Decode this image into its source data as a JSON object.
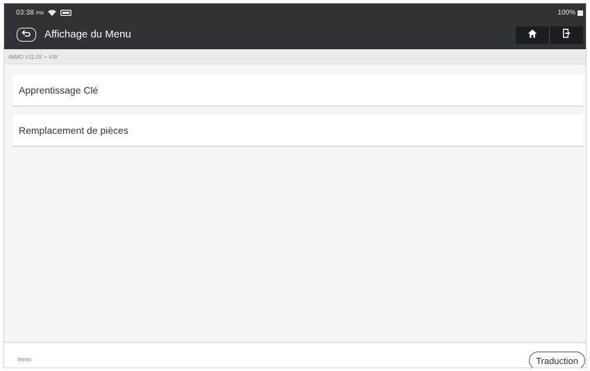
{
  "status_bar": {
    "time": "03:38",
    "period": "PM",
    "battery": "100%"
  },
  "header": {
    "title": "Affichage du Menu",
    "icons": [
      "back-arrow-icon",
      "home-icon",
      "exit-icon"
    ]
  },
  "breadcrumb": "IMMO V11.05 > VW",
  "menu": {
    "items": [
      {
        "label": "Apprentissage Clé"
      },
      {
        "label": "Remplacement de pièces"
      }
    ]
  },
  "footer": {
    "label": "Immo",
    "translate_label": "Traduction"
  },
  "colors": {
    "header_bg": "#2f3336",
    "nav_button_bg": "#1b1d1f",
    "page_bg": "#f5f5f5",
    "item_bg": "#ffffff"
  }
}
